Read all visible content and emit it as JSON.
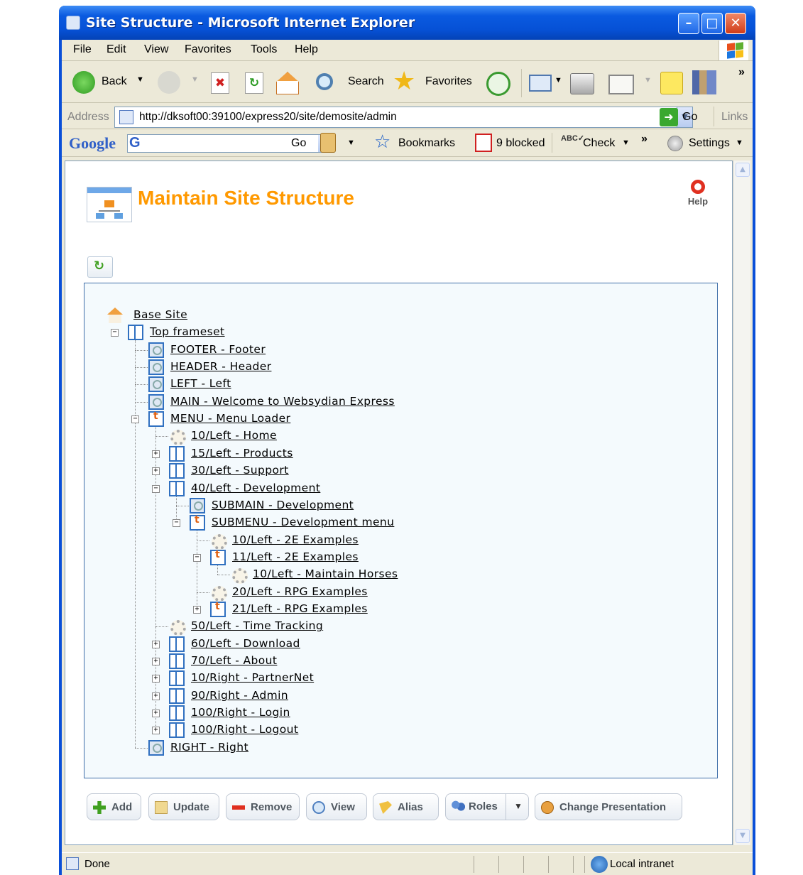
{
  "window": {
    "title": "Site Structure - Microsoft Internet Explorer"
  },
  "menubar": {
    "items": [
      "File",
      "Edit",
      "View",
      "Favorites",
      "Tools",
      "Help"
    ]
  },
  "toolbar": {
    "back": "Back",
    "search": "Search",
    "favorites": "Favorites"
  },
  "address": {
    "label": "Address",
    "url": "http://dksoft00:39100/express20/site/demosite/admin",
    "go": "Go",
    "links": "Links"
  },
  "googlebar": {
    "logo": "Google",
    "go": "Go",
    "bookmarks": "Bookmarks",
    "blocked": "9 blocked",
    "check": "Check",
    "settings": "Settings"
  },
  "page": {
    "title": "Maintain Site Structure",
    "help": "Help",
    "tree": [
      {
        "label": "Base Site",
        "icon": "home-icon"
      },
      {
        "label": "Top frameset",
        "icon": "frameset-icon"
      },
      {
        "label": "FOOTER - Footer",
        "icon": "component-icon"
      },
      {
        "label": "HEADER - Header",
        "icon": "component-icon"
      },
      {
        "label": "LEFT - Left",
        "icon": "component-icon"
      },
      {
        "label": "MAIN - Welcome to Websydian Express",
        "icon": "component-icon"
      },
      {
        "label": "MENU - Menu Loader",
        "icon": "menu-icon"
      },
      {
        "label": "10/Left - Home",
        "icon": "page-icon"
      },
      {
        "label": "15/Left - Products",
        "icon": "frameset-icon"
      },
      {
        "label": "30/Left - Support",
        "icon": "frameset-icon"
      },
      {
        "label": "40/Left - Development",
        "icon": "frameset-icon"
      },
      {
        "label": "SUBMAIN - Development",
        "icon": "component-icon"
      },
      {
        "label": "SUBMENU - Development menu",
        "icon": "menu-icon"
      },
      {
        "label": "10/Left - 2E Examples",
        "icon": "page-icon"
      },
      {
        "label": "11/Left - 2E Examples",
        "icon": "menu-icon"
      },
      {
        "label": "10/Left - Maintain Horses",
        "icon": "page-icon"
      },
      {
        "label": "20/Left - RPG Examples",
        "icon": "page-icon"
      },
      {
        "label": "21/Left - RPG Examples",
        "icon": "menu-icon"
      },
      {
        "label": "50/Left - Time Tracking",
        "icon": "page-icon"
      },
      {
        "label": "60/Left - Download",
        "icon": "frameset-icon"
      },
      {
        "label": "70/Left - About",
        "icon": "frameset-icon"
      },
      {
        "label": "10/Right - PartnerNet",
        "icon": "frameset-icon"
      },
      {
        "label": "90/Right - Admin",
        "icon": "frameset-icon"
      },
      {
        "label": "100/Right - Login",
        "icon": "frameset-icon"
      },
      {
        "label": "100/Right - Logout",
        "icon": "frameset-icon"
      },
      {
        "label": "RIGHT - Right",
        "icon": "component-icon"
      }
    ],
    "buttons": {
      "add": "Add",
      "update": "Update",
      "remove": "Remove",
      "view": "View",
      "alias": "Alias",
      "roles": "Roles",
      "change_presentation": "Change Presentation"
    }
  },
  "status": {
    "text": "Done",
    "zone": "Local intranet"
  },
  "colors": {
    "title_orange": "#ff9900",
    "xp_blue": "#0a4fd8",
    "tree_border": "#3e6ea8"
  }
}
